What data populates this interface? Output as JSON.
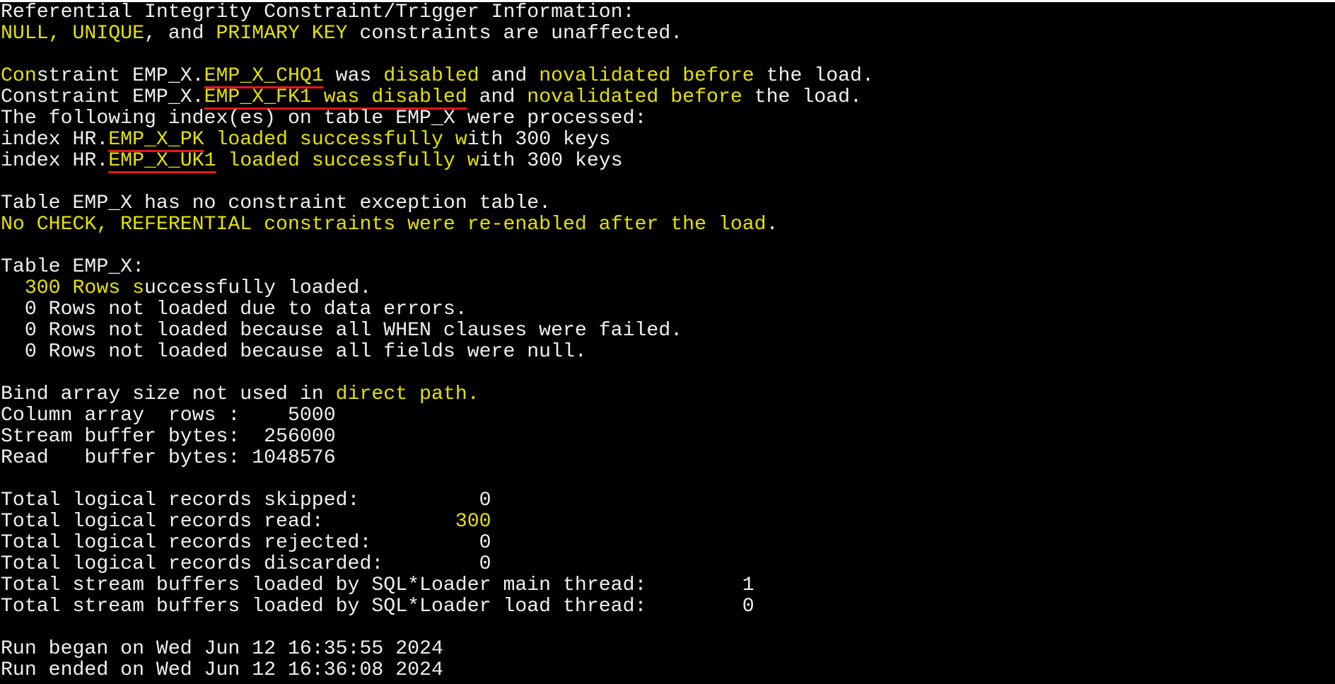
{
  "colors": {
    "background": "#000000",
    "text": "#f0f0f0",
    "highlight": "#e5e100",
    "annotation_underline": "#e8141c"
  },
  "lines": [
    [
      {
        "t": "Referential Integrity Constraint/Trigger Information:",
        "c": "w"
      }
    ],
    [
      {
        "t": "NULL, UNIQUE",
        "c": "y"
      },
      {
        "t": ", and ",
        "c": "w"
      },
      {
        "t": "PRIMARY KEY",
        "c": "y"
      },
      {
        "t": " constraints are unaffected.",
        "c": "w"
      }
    ],
    [],
    [
      {
        "t": "Con",
        "c": "y"
      },
      {
        "t": "straint EMP_X.",
        "c": "w"
      },
      {
        "t": "EMP_X_CHQ1",
        "c": "y",
        "u": true
      },
      {
        "t": " was ",
        "c": "w"
      },
      {
        "t": "disabled",
        "c": "y"
      },
      {
        "t": " and ",
        "c": "w"
      },
      {
        "t": "novalidated before",
        "c": "y"
      },
      {
        "t": " the load.",
        "c": "w"
      }
    ],
    [
      {
        "t": "Constraint EMP_X.",
        "c": "w"
      },
      {
        "t": "EMP_X_FK1 was disabled",
        "c": "y",
        "u": true
      },
      {
        "t": " and ",
        "c": "w"
      },
      {
        "t": "novalidated before",
        "c": "y"
      },
      {
        "t": " the load.",
        "c": "w"
      }
    ],
    [
      {
        "t": "The following index(es) on table EMP_X were processed:",
        "c": "w"
      }
    ],
    [
      {
        "t": "index HR.",
        "c": "w"
      },
      {
        "t": "EMP_X_PK",
        "c": "y",
        "u": true
      },
      {
        "t": " loaded successfully w",
        "c": "y"
      },
      {
        "t": "ith 300 keys",
        "c": "w"
      }
    ],
    [
      {
        "t": "index HR.",
        "c": "w"
      },
      {
        "t": "EMP_X_UK1",
        "c": "y",
        "u": true
      },
      {
        "t": " loaded successfully w",
        "c": "y"
      },
      {
        "t": "ith 300 keys",
        "c": "w"
      }
    ],
    [],
    [
      {
        "t": "Table EMP_X has no constraint exception table.",
        "c": "w"
      }
    ],
    [
      {
        "t": "No CHECK, REFERENTIAL constraints were re-enabled after the load",
        "c": "y"
      },
      {
        "t": ".",
        "c": "w"
      }
    ],
    [],
    [
      {
        "t": "Table EMP_X:",
        "c": "w"
      }
    ],
    [
      {
        "t": "  ",
        "c": "w"
      },
      {
        "t": "300 Rows s",
        "c": "y"
      },
      {
        "t": "uccessfully loaded.",
        "c": "w"
      }
    ],
    [
      {
        "t": "  0 Rows not loaded due to data errors.",
        "c": "w"
      }
    ],
    [
      {
        "t": "  0 Rows not loaded because all WHEN clauses were failed.",
        "c": "w"
      }
    ],
    [
      {
        "t": "  0 Rows not loaded because all fields were null.",
        "c": "w"
      }
    ],
    [],
    [
      {
        "t": "Bind array size not used in ",
        "c": "w"
      },
      {
        "t": "direct path.",
        "c": "y"
      }
    ],
    [
      {
        "t": "Column array  rows :    5000",
        "c": "w"
      }
    ],
    [
      {
        "t": "Stream buffer bytes:  256000",
        "c": "w"
      }
    ],
    [
      {
        "t": "Read   buffer bytes: 1048576",
        "c": "w"
      }
    ],
    [],
    [
      {
        "t": "Total logical records skipped:          0",
        "c": "w"
      }
    ],
    [
      {
        "t": "Total logical records read:           ",
        "c": "w"
      },
      {
        "t": "300",
        "c": "y"
      }
    ],
    [
      {
        "t": "Total logical records rejected:         0",
        "c": "w"
      }
    ],
    [
      {
        "t": "Total logical records discarded:        0",
        "c": "w"
      }
    ],
    [
      {
        "t": "Total stream buffers loaded by SQL*Loader main thread:        1",
        "c": "w"
      }
    ],
    [
      {
        "t": "Total stream buffers loaded by SQL*Loader load thread:        0",
        "c": "w"
      }
    ],
    [],
    [
      {
        "t": "Run began on Wed Jun 12 16:35:55 2024",
        "c": "w"
      }
    ],
    [
      {
        "t": "Run ended on Wed Jun 12 16:36:08 2024",
        "c": "w"
      }
    ]
  ]
}
